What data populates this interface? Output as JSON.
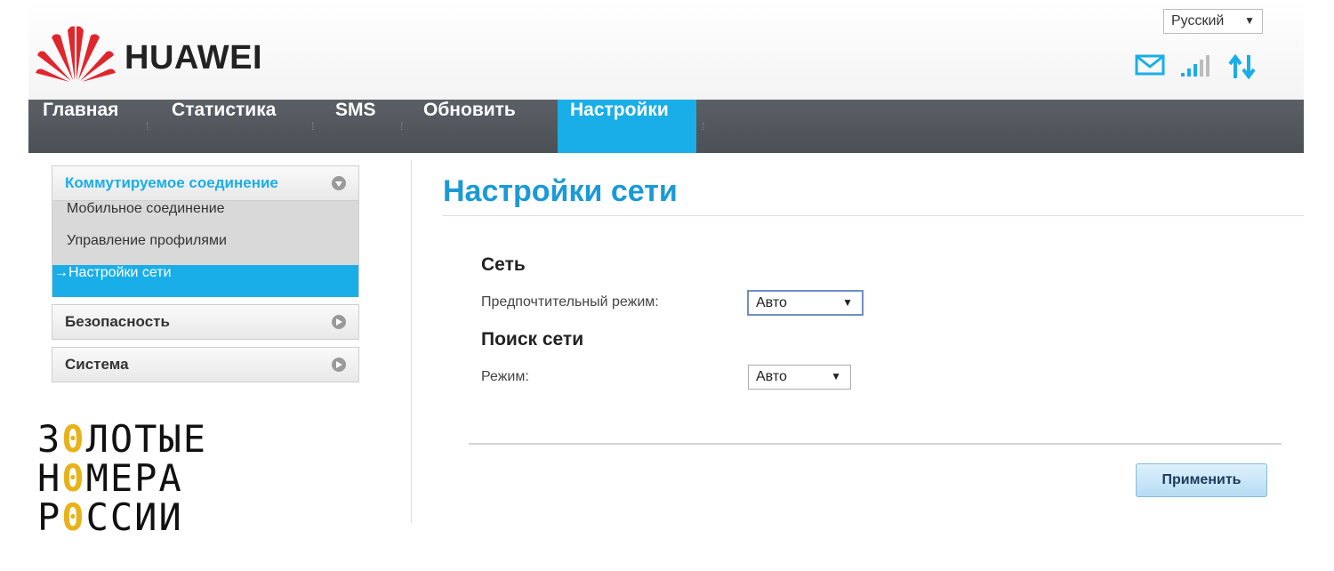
{
  "header": {
    "brand": "HUAWEI",
    "language": "Русский",
    "icons": [
      "mail-icon",
      "signal-strength-icon",
      "data-transfer-icon"
    ]
  },
  "nav": {
    "items": [
      {
        "label": "Главная"
      },
      {
        "label": "Статистика"
      },
      {
        "label": "SMS"
      },
      {
        "label": "Обновить"
      },
      {
        "label": "Настройки",
        "active": true
      }
    ]
  },
  "sidebar": {
    "groups": [
      {
        "label": "Коммутируемое соединение",
        "expanded": true,
        "items": [
          {
            "label": "Мобильное соединение"
          },
          {
            "label": "Управление профилями"
          },
          {
            "label": "→Настройки сети",
            "active": true
          }
        ]
      },
      {
        "label": "Безопасность",
        "expanded": false
      },
      {
        "label": "Система",
        "expanded": false
      }
    ]
  },
  "main": {
    "title": "Настройки сети",
    "network": {
      "heading": "Сеть",
      "preferred_mode_label": "Предпочтительный режим:",
      "preferred_mode_value": "Авто"
    },
    "search": {
      "heading": "Поиск сети",
      "mode_label": "Режим:",
      "mode_value": "Авто"
    },
    "apply_label": "Применить"
  },
  "watermark": {
    "lines": [
      {
        "pre": "З",
        "zero": "0",
        "post": "ЛОТЫЕ"
      },
      {
        "pre": "Н",
        "zero": "0",
        "post": "МЕРА"
      },
      {
        "pre": "Р",
        "zero": "0",
        "post": "ССИИ"
      }
    ]
  },
  "colors": {
    "accent": "#1aaee8",
    "title": "#1a9ad6",
    "navbar": "#4f555a",
    "logo_red": "#e0262d",
    "watermark_gold": "#e8b21a"
  }
}
